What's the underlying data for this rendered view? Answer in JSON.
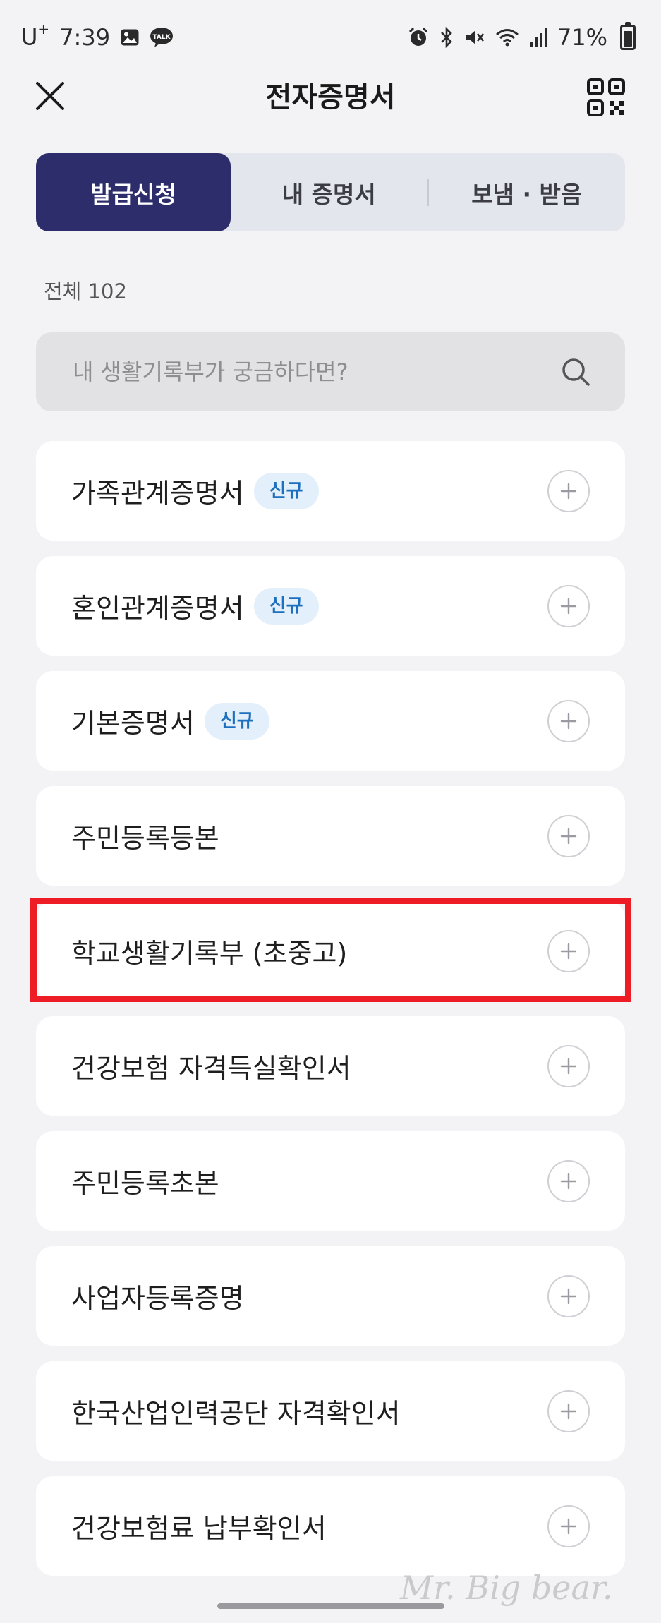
{
  "status_bar": {
    "carrier": "U",
    "carrier_mark": "+",
    "time": "7:39",
    "battery": "71%",
    "battery_level": 0.71,
    "icons_left": [
      "gallery-icon",
      "talk-icon"
    ],
    "icons_right": [
      "alarm-icon",
      "bluetooth-icon",
      "mute-icon",
      "wifi-icon",
      "signal-icon",
      "battery-icon"
    ]
  },
  "header": {
    "title": "전자증명서",
    "close_icon": "close-icon",
    "qr_icon": "qr-code-icon"
  },
  "tabs": [
    {
      "label": "발급신청",
      "active": true
    },
    {
      "label": "내 증명서",
      "active": false
    },
    {
      "label": "보냄 · 받음",
      "active": false
    }
  ],
  "total_count": "전체 102",
  "search": {
    "placeholder": "내 생활기록부가 궁금하다면?",
    "icon": "search-icon"
  },
  "certificates": [
    {
      "name": "가족관계증명서",
      "badge": "신규"
    },
    {
      "name": "혼인관계증명서",
      "badge": "신규"
    },
    {
      "name": "기본증명서",
      "badge": "신규"
    },
    {
      "name": "주민등록등본",
      "badge": ""
    },
    {
      "name": "학교생활기록부 (초중고)",
      "badge": "",
      "highlighted": true
    },
    {
      "name": "건강보험 자격득실확인서",
      "badge": ""
    },
    {
      "name": "주민등록초본",
      "badge": ""
    },
    {
      "name": "사업자등록증명",
      "badge": ""
    },
    {
      "name": "한국산업인력공단 자격확인서",
      "badge": ""
    },
    {
      "name": "건강보험료 납부확인서",
      "badge": ""
    }
  ],
  "colors": {
    "active_tab": "#2c2d6a",
    "badge_text": "#1e6fbd",
    "badge_bg": "#e3f0fb",
    "highlight": "#ee1c24"
  },
  "watermark": "Mr. Big bear."
}
